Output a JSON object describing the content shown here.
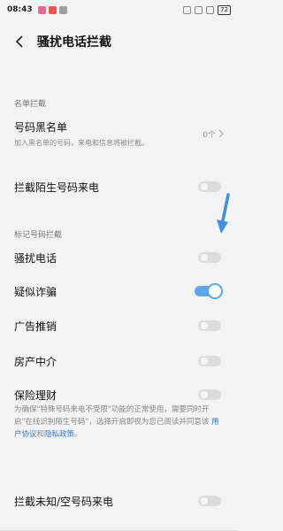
{
  "status": {
    "time": "08:43",
    "battery": "72"
  },
  "header": {
    "title": "骚扰电话拦截"
  },
  "blacklist_section": {
    "label": "名单拦截",
    "blacklist": {
      "title": "号码黑名单",
      "subtitle": "加入黑名单的号码，来电和信息将被拦截。",
      "count": "0个"
    },
    "strangers": {
      "title": "拦截陌生号码来电",
      "enabled": false
    }
  },
  "marked_section": {
    "label": "标记号码拦截",
    "items": [
      {
        "title": "骚扰电话",
        "enabled": false
      },
      {
        "title": "疑似诈骗",
        "enabled": true
      },
      {
        "title": "广告推销",
        "enabled": false
      },
      {
        "title": "房产中介",
        "enabled": false
      },
      {
        "title": "保险理财",
        "enabled": false
      }
    ]
  },
  "notice": {
    "text": "为确保\"特殊号码来电不受限\"功能的正常使用，需要同时开启\"在线识别陌生号码\"，选择开启即视为您已阅读并同意该",
    "user_agreement": "用户协议",
    "and": "和",
    "privacy_policy": "隐私政策",
    "end": "。"
  },
  "unknown_calls": {
    "title": "拦截未知/空号码来电",
    "enabled": false
  },
  "colors": {
    "accent": "#5aa7ec",
    "link": "#2f7bd8",
    "arrow": "#3d8fe0"
  }
}
